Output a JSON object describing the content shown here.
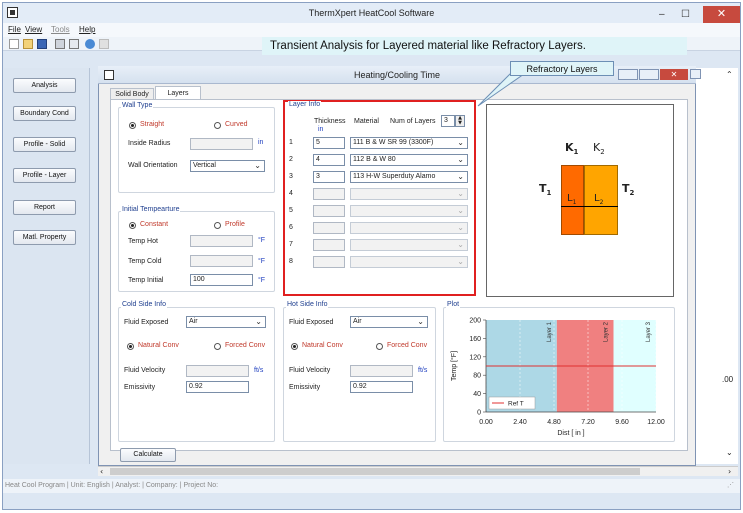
{
  "window": {
    "title": "ThermXpert HeatCool Software",
    "min": "–",
    "max": "☐",
    "close": "✕"
  },
  "menu": {
    "file": "File",
    "view": "View",
    "tools": "Tools",
    "help": "Help"
  },
  "banner": "Transient Analysis for Layered material like Refractory Layers.",
  "callout": "Refractory Layers",
  "sidebar": [
    "Analysis",
    "Boundary Cond",
    "Profile - Solid",
    "Profile - Layer",
    "Report",
    "Matl. Property"
  ],
  "child": {
    "title": "Heating/Cooling Time"
  },
  "tabs": [
    "Solid Body",
    "Layers"
  ],
  "wall_type": {
    "label": "Wall Type",
    "straight": "Straight",
    "curved": "Curved",
    "inside_radius_label": "Inside Radius",
    "inside_radius_unit": "in",
    "inside_radius": "",
    "orientation_label": "Wall Orientation",
    "orientation": "Vertical"
  },
  "initial_temp": {
    "label": "Initial Tempearture",
    "constant": "Constant",
    "profile": "Profile",
    "hot_label": "Temp Hot",
    "hot": "",
    "hot_unit": "°F",
    "cold_label": "Temp Cold",
    "cold": "",
    "cold_unit": "°F",
    "initial_label": "Temp Initial",
    "initial": "100",
    "initial_unit": "°F"
  },
  "layer_info": {
    "label": "Layer Info",
    "thickness_label": "Thickness",
    "thickness_unit": "in",
    "material_label": "Material",
    "num_layers_label": "Num of Layers",
    "num_layers": "3",
    "rows": [
      {
        "n": "1",
        "thickness": "5",
        "material": "111 B & W SR 99 (3300F)"
      },
      {
        "n": "2",
        "thickness": "4",
        "material": "112 B & W 80"
      },
      {
        "n": "3",
        "thickness": "3",
        "material": "113 H-W Superduty Alamo"
      },
      {
        "n": "4",
        "thickness": "",
        "material": ""
      },
      {
        "n": "5",
        "thickness": "",
        "material": ""
      },
      {
        "n": "6",
        "thickness": "",
        "material": ""
      },
      {
        "n": "7",
        "thickness": "",
        "material": ""
      },
      {
        "n": "8",
        "thickness": "",
        "material": ""
      }
    ]
  },
  "diagram": {
    "k1": "K",
    "k1sub": "1",
    "k2": "K",
    "k2sub": "2",
    "t1": "T",
    "t1sub": "1",
    "t2": "T",
    "t2sub": "2",
    "l1": "L",
    "l1sub": "1",
    "l2": "L",
    "l2sub": "2"
  },
  "cold_side": {
    "label": "Cold Side Info",
    "fluid_label": "Fluid Exposed",
    "fluid": "Air",
    "natural": "Natural Conv",
    "forced": "Forced Conv",
    "velocity_label": "Fluid Velocity",
    "velocity": "",
    "velocity_unit": "ft/s",
    "emissivity_label": "Emissivity",
    "emissivity": "0.92"
  },
  "hot_side": {
    "label": "Hot Side Info",
    "fluid_label": "Fluid Exposed",
    "fluid": "Air",
    "natural": "Natural Conv",
    "forced": "Forced Conv",
    "velocity_label": "Fluid Velocity",
    "velocity": "",
    "velocity_unit": "ft/s",
    "emissivity_label": "Emissivity",
    "emissivity": "0.92"
  },
  "plot_label": "Plot",
  "calculate": "Calculate",
  "right_edge_value": ".00",
  "status": "Heat Cool Program  | Unit: English  | Analyst:   | Company:   | Project No:",
  "colors": {
    "layer1": "#add8e6",
    "layer2": "#f08080",
    "layer3": "#e0ffff",
    "ref": "#e03030",
    "k1": "#ff6a00",
    "k2": "#ffa500",
    "accent_red": "#e02020"
  },
  "chart_data": {
    "type": "line",
    "title": "",
    "xlabel": "Dist [ in ]",
    "ylabel": "Temp [°F]",
    "xlim": [
      0,
      12
    ],
    "ylim": [
      0,
      200
    ],
    "x_ticks": [
      "0.00",
      "2.40",
      "4.80",
      "7.20",
      "9.60",
      "12.00"
    ],
    "y_ticks": [
      "0",
      "40",
      "80",
      "120",
      "160",
      "200"
    ],
    "regions": [
      {
        "name": "Layer 1",
        "x0": 0,
        "x1": 5
      },
      {
        "name": "Layer 2",
        "x0": 5,
        "x1": 9
      },
      {
        "name": "Layer 3",
        "x0": 9,
        "x1": 12
      }
    ],
    "series": [
      {
        "name": "Ref T",
        "x": [
          0,
          12
        ],
        "y": [
          100,
          100
        ]
      }
    ],
    "legend": "bottom-left"
  }
}
